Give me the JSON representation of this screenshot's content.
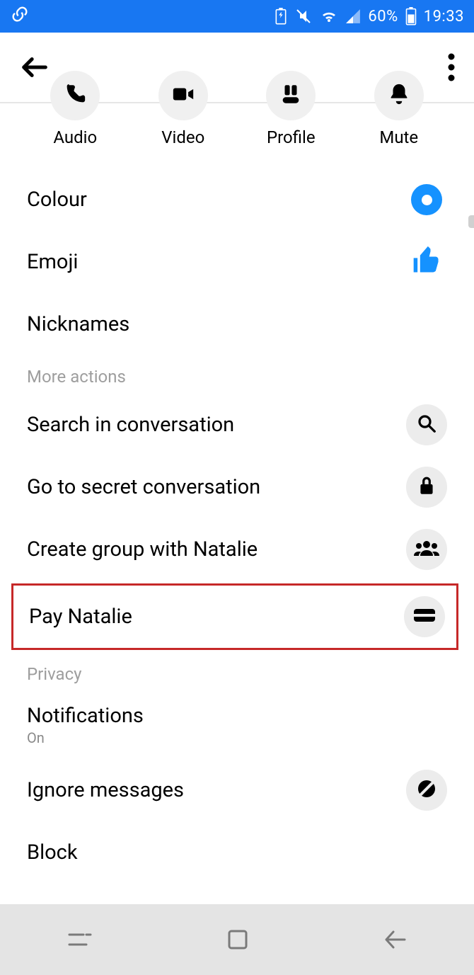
{
  "status": {
    "battery_pct": "60%",
    "time": "19:33"
  },
  "quick": {
    "audio": "Audio",
    "video": "Video",
    "profile": "Profile",
    "mute": "Mute"
  },
  "settings": {
    "colour": "Colour",
    "emoji": "Emoji",
    "nicknames": "Nicknames"
  },
  "headers": {
    "more_actions": "More actions",
    "privacy": "Privacy"
  },
  "more_actions": {
    "search": "Search in conversation",
    "secret": "Go to secret conversation",
    "create_group": "Create group with Natalie",
    "pay": "Pay Natalie"
  },
  "privacy": {
    "notifications_label": "Notifications",
    "notifications_value": "On",
    "ignore": "Ignore messages",
    "block": "Block"
  }
}
